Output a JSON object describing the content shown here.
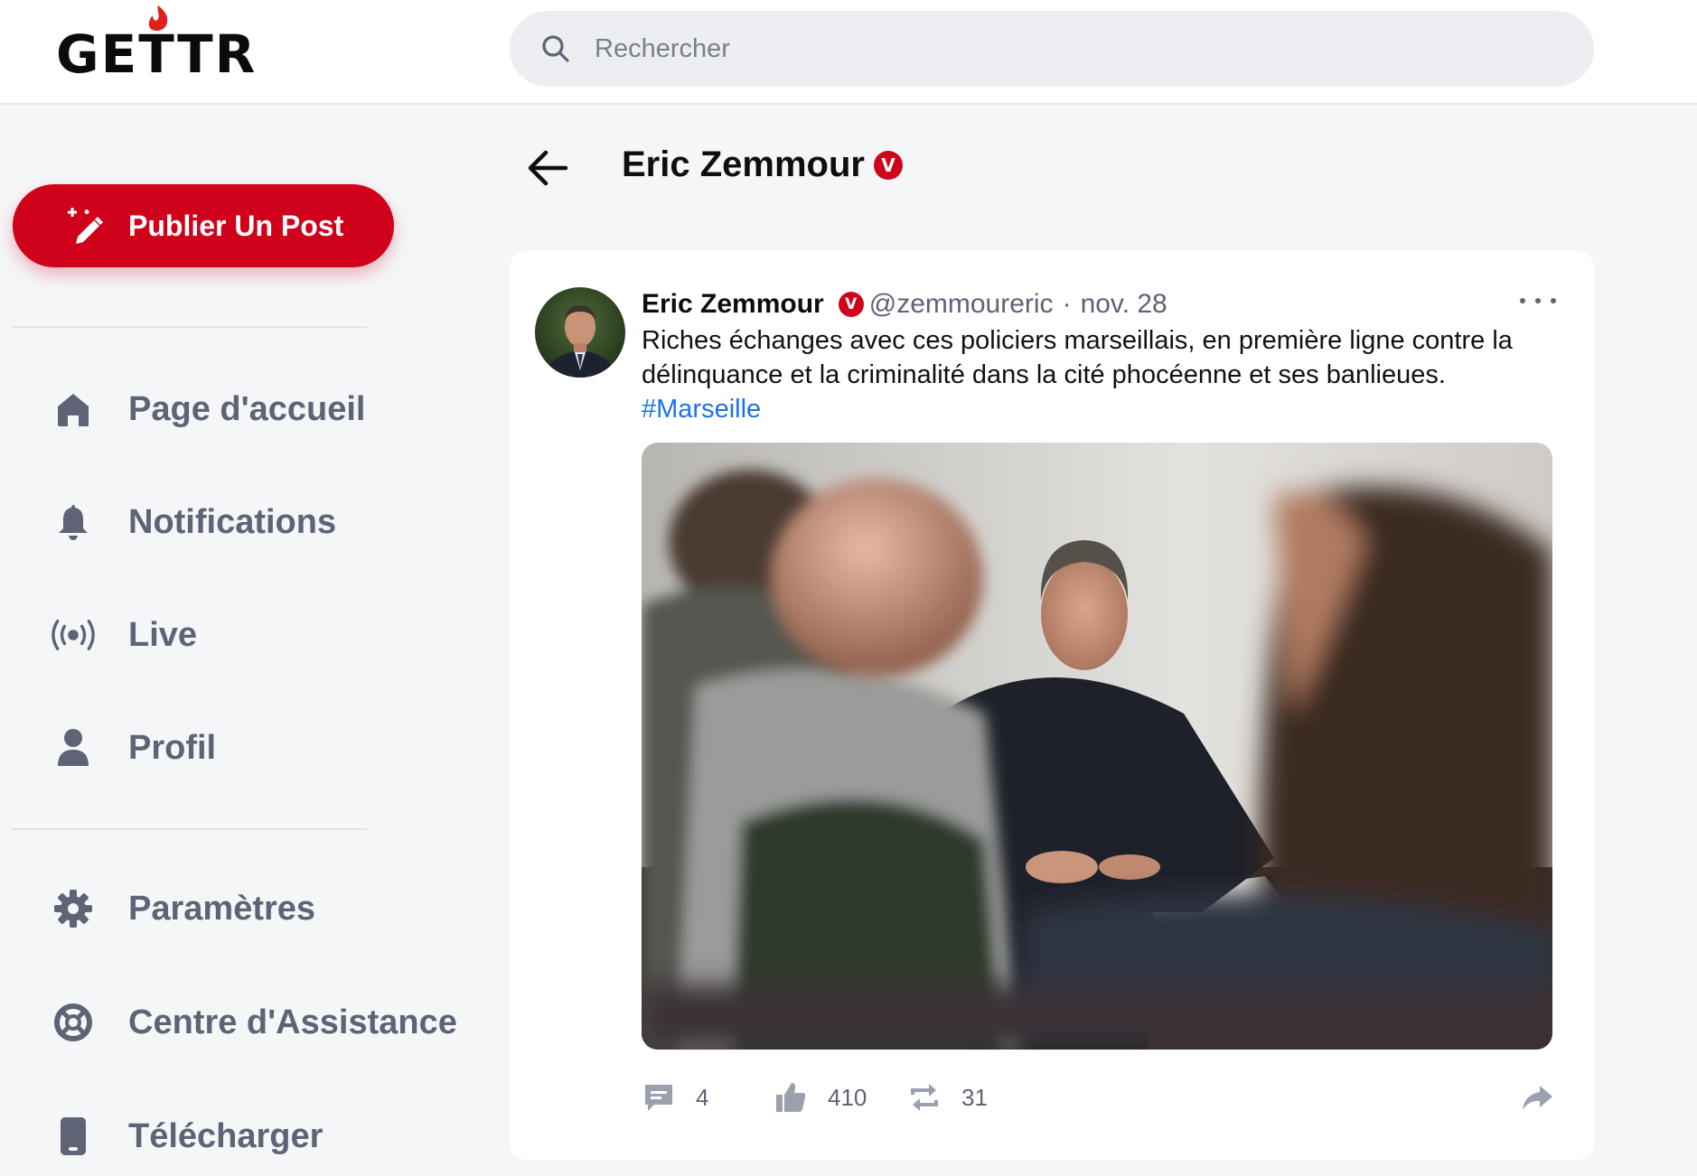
{
  "app": {
    "logo_text": "GETTR"
  },
  "search": {
    "placeholder": "Rechercher"
  },
  "sidebar": {
    "publish_label": "Publier Un Post",
    "items": [
      {
        "label": "Page d'accueil",
        "icon": "home-icon"
      },
      {
        "label": "Notifications",
        "icon": "bell-icon"
      },
      {
        "label": "Live",
        "icon": "broadcast-icon"
      },
      {
        "label": "Profil",
        "icon": "user-icon"
      },
      {
        "label": "Paramètres",
        "icon": "gear-icon"
      },
      {
        "label": "Centre d'Assistance",
        "icon": "lifebuoy-icon"
      },
      {
        "label": "Télécharger",
        "icon": "phone-icon"
      }
    ]
  },
  "header": {
    "title": "Eric Zemmour",
    "verified_badge": "V"
  },
  "post": {
    "author": "Eric Zemmour",
    "verified_badge": "V",
    "handle": "@zemmoureric",
    "separator": "·",
    "date": "nov. 28",
    "text": "Riches échanges avec ces policiers marseillais, en première ligne contre la délinquance et la criminalité dans la cité phocéenne et ses banlieues.",
    "hashtag": "#Marseille",
    "stats": {
      "comments": "4",
      "likes": "410",
      "reposts": "31"
    }
  },
  "colors": {
    "brand": "#d0021b",
    "link": "#1a73e8",
    "muted": "#5e6376"
  }
}
